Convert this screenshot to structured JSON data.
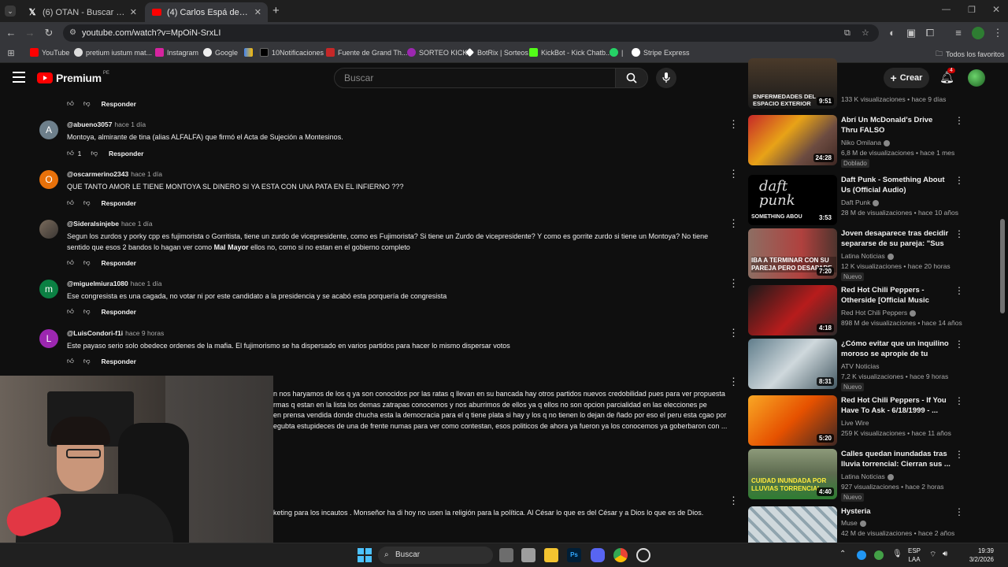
{
  "browser": {
    "tabs": [
      {
        "title": "(6) OTAN - Buscar / X",
        "active": false
      },
      {
        "title": "(4) Carlos Espá defiende inclusió",
        "active": true
      }
    ],
    "new_tab": "+",
    "url": "youtube.com/watch?v=MpOiN-SrxLI",
    "bookmarks": [
      "YouTube",
      "pretium iustum mat...",
      "Instagram",
      "Google",
      "",
      "10Notificaciones",
      "Fuente de Grand Th...",
      "SORTEO KICK",
      "BotRix | Sorteos",
      "KickBot - Kick Chatb...",
      "|",
      "Stripe Express"
    ],
    "all_favorites": "Todos los favoritos"
  },
  "youtube": {
    "logo": "Premium",
    "region": "PE",
    "search_placeholder": "Buscar",
    "create_label": "Crear",
    "notif_count": "4"
  },
  "comments": [
    {
      "handle": "",
      "time": "",
      "text": "",
      "likes": "",
      "reply": "Responder"
    },
    {
      "handle": "@abueno3057",
      "time": "hace 1 día",
      "avatar_letter": "A",
      "avatar_color": "#6d7f8b",
      "text": "Montoya, almirante de tina (alias ALFALFA) que firmó el Acta de Sujeción a Montesinos.",
      "likes": "1",
      "reply": "Responder"
    },
    {
      "handle": "@oscarmerino2343",
      "time": "hace 1 día",
      "avatar_letter": "O",
      "avatar_color": "#e8710a",
      "text": "QUE TANTO AMOR LE TIENE MONTOYA SL DINERO SI YA ESTA CON UNA PATA EN EL INFIERNO ???",
      "likes": "",
      "reply": "Responder"
    },
    {
      "handle": "@Sideralsinjebe",
      "time": "hace 1 día",
      "avatar_letter": "",
      "avatar_color": "#5a5550",
      "text_a": "Segun los zurdos y porky cpp es fujimorista o Gorritista, tiene un zurdo de vicepresidente, como es Fujimorista? Si tiene un Zurdo de vicepresidente? Y como es gorrite zurdo si tiene un Montoya? No tiene sentido que esos 2 bandos lo hagan ver como ",
      "text_bold": "Mal Mayor",
      "text_b": " ellos no, como si no estan en el gobierno completo",
      "likes": "",
      "reply": "Responder"
    },
    {
      "handle": "@miguelmiura1080",
      "time": "hace 1 día",
      "avatar_letter": "m",
      "avatar_color": "#0b8043",
      "text": "Ese congresista es una cagada, no votar ni por este candidato a la presidencia y se acabó esta porquería de congresista",
      "likes": "",
      "reply": "Responder"
    },
    {
      "handle": "@LuisCondori-f1i",
      "time": "hace 9 horas",
      "avatar_letter": "L",
      "avatar_color": "#9c27b0",
      "text": "Este payaso serio solo obedece ordenes de la mafia. El fujimorismo se ha dispersado en varios partidos para hacer lo mismo dispersar votos",
      "likes": "",
      "reply": "Responder"
    }
  ],
  "partial_comment": [
    "n nos haryamos de los q ya son conocidos por las ratas q llevan en su bancada hay otros partidos nuevos credobilidad pues para ver propuesta",
    "rmas q estan en la lista los demas zatrapas conocemos y nos aburrimos de ellos ya q ellos no son opcion parcialidad en las elecciones pe",
    "en prensa vendida donde chucha esta la democracia para el q tiene plata si hay y los q no tienen lo dejan de ñado por eso el peru esta cgao por",
    "egubta estupideces de una de frente numas para ver como contestan, esos politicos de ahora ya fueron ya los conocemos ya goberbaron con ..."
  ],
  "partial_comment_2": "keting para los incautos . Monseñor ha di hoy no usen la religión para la política. Al César lo que es del César y a Dios lo que es de Dios.",
  "sidebar": [
    {
      "title": "",
      "thumb_text": "ENFERMEDADES DEL ESPACIO EXTERIOR",
      "duration": "9:51",
      "channel": "",
      "meta": "133 K visualizaciones • hace 9 días",
      "badge": ""
    },
    {
      "title": "Abrí Un McDonald's Drive Thru FALSO",
      "thumb_text": "",
      "duration": "24:28",
      "channel": "Niko Omilana",
      "meta": "6,8 M de visualizaciones • hace 1 mes",
      "badge": "Doblado"
    },
    {
      "title": "Daft Punk - Something About Us (Official Audio)",
      "thumb_text": "SOMETHING ABOU",
      "duration": "3:53",
      "channel": "Daft Punk",
      "meta": "28 M de visualizaciones • hace 10 años",
      "badge": ""
    },
    {
      "title": "Joven desaparece tras decidir separarse de su pareja: \"Sus ...",
      "thumb_text": "IBA A TERMINAR CON SU PAREJA PERO DESAPARE",
      "duration": "7:20",
      "channel": "Latina Noticias",
      "meta": "12 K visualizaciones • hace 20 horas",
      "badge": "Nuevo"
    },
    {
      "title": "Red Hot Chili Peppers - Otherside [Official Music Vide...",
      "thumb_text": "",
      "duration": "4:18",
      "channel": "Red Hot Chili Peppers",
      "meta": "898 M de visualizaciones • hace 14 años",
      "badge": ""
    },
    {
      "title": "¿Cómo evitar que un inquilino moroso se apropie de tu hogar?",
      "thumb_text": "",
      "duration": "8:31",
      "channel": "ATV Noticias",
      "meta": "7,2 K visualizaciones • hace 9 horas",
      "badge": "Nuevo"
    },
    {
      "title": "Red Hot Chili Peppers - If You Have To Ask - 6/18/1999 - ...",
      "thumb_text": "",
      "duration": "5:20",
      "channel": "Live Wire",
      "meta": "259 K visualizaciones • hace 11 años",
      "badge": ""
    },
    {
      "title": "Calles quedan inundadas tras lluvia torrencial: Cierran sus ...",
      "thumb_text": "CUIDAD INUNDADA POR LLUVIAS TORRENCIAL",
      "duration": "4:40",
      "channel": "Latina Noticias",
      "meta": "927 visualizaciones • hace 2 horas",
      "badge": "Nuevo"
    },
    {
      "title": "Hysteria",
      "thumb_text": "",
      "duration": "",
      "channel": "Muse",
      "meta": "42 M de visualizaciones • hace 2 años",
      "badge": ""
    }
  ],
  "taskbar": {
    "search": "Buscar",
    "lang_top": "ESP",
    "lang_bottom": "LAA",
    "time": "19:39",
    "date": "3/2/2026"
  }
}
